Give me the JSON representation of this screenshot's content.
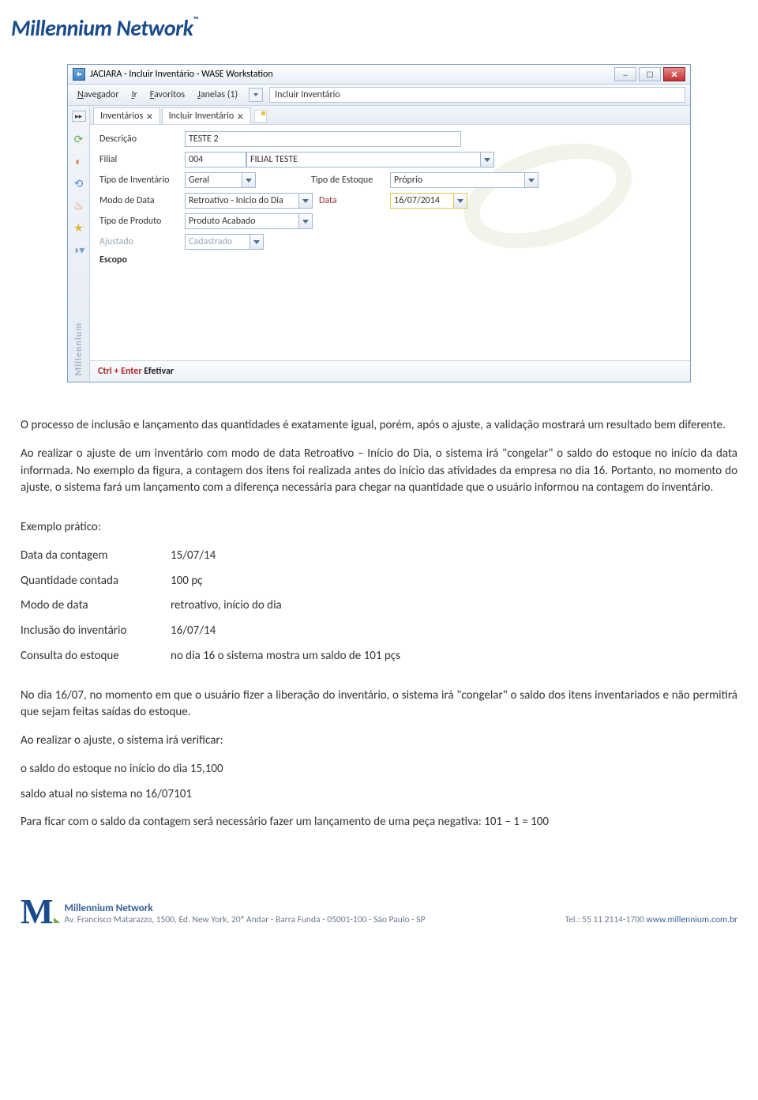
{
  "brand": {
    "title": "Millennium Network",
    "tm": "™"
  },
  "window": {
    "title": "JACIARA - Incluir Inventário - WASE Workstation",
    "menus": {
      "navegador": "Navegador",
      "ir": "Ir",
      "favoritos": "Favoritos",
      "janelas": "Janelas (1)",
      "path": "Incluir Inventário"
    },
    "tabs": {
      "t1": "Inventários",
      "t2": "Incluir Inventário"
    },
    "form": {
      "descricao_label": "Descrição",
      "descricao_value": "TESTE 2",
      "filial_label": "Filial",
      "filial_code": "004",
      "filial_name": "FILIAL TESTE",
      "tipo_inv_label": "Tipo de Inventário",
      "tipo_inv_value": "Geral",
      "tipo_est_label": "Tipo de Estoque",
      "tipo_est_value": "Próprio",
      "modo_data_label": "Modo de Data",
      "modo_data_value": "Retroativo - Inicio do Dia",
      "data_label": "Data",
      "data_value": "16/07/2014",
      "tipo_prod_label": "Tipo de Produto",
      "tipo_prod_value": "Produto Acabado",
      "ajustado_label": "Ajustado",
      "ajustado_value": "Cadastrado",
      "escopo_label": "Escopo"
    },
    "rail_text": "Millennium",
    "footer": {
      "kbd": "Ctrl + Enter",
      "action": "Efetivar"
    }
  },
  "doc": {
    "p1": "O processo de inclusão e lançamento das quantidades é exatamente igual, porém, após o ajuste, a validação mostrará um resultado bem diferente.",
    "p2": "Ao realizar o ajuste de um inventário com modo de data Retroativo – Início do Dia, o sistema irá \"congelar\" o saldo do estoque no início da data informada. No exemplo da figura, a contagem dos itens foi realizada antes do início das atividades da empresa no dia 16. Portanto, no momento do ajuste, o sistema fará um lançamento com a diferença necessária para chegar na quantidade que o usuário informou na contagem do inventário.",
    "ex_title": "Exemplo prático:",
    "ex": {
      "r1l": "Data da contagem",
      "r1v": "15/07/14",
      "r2l": "Quantidade contada",
      "r2v": "100 pç",
      "r3l": "Modo de data",
      "r3v": "retroativo, início do dia",
      "r4l": "Inclusão do inventário",
      "r4v": "16/07/14",
      "r5l": "Consulta do estoque",
      "r5v": "no dia 16 o sistema mostra um saldo de 101 pçs"
    },
    "p3": "No dia 16/07, no momento em que o usuário fizer a liberação do inventário, o sistema irá \"congelar\" o saldo dos itens inventariados e não permitirá que sejam feitas saídas do estoque.",
    "p4": "Ao realizar o ajuste, o sistema irá verificar:",
    "r6l": " o saldo do estoque no início do dia 15,",
    "r6v": "100",
    "r7l": "saldo atual no sistema no 16/07",
    "r7v": "101",
    "p5": "Para ficar com o saldo da contagem será necessário fazer um lançamento de uma peça negativa: 101 – 1 = 100"
  },
  "footer": {
    "name": "Millennium Network",
    "address": "Av. Francisco Matarazzo, 1500, Ed. New York, 20º Andar  - Barra Funda - 05001-100 - São Paulo - SP",
    "tel_label": "Tel.:",
    "tel": "55 11 2114-1700",
    "site": "www.millennium.com.br"
  }
}
